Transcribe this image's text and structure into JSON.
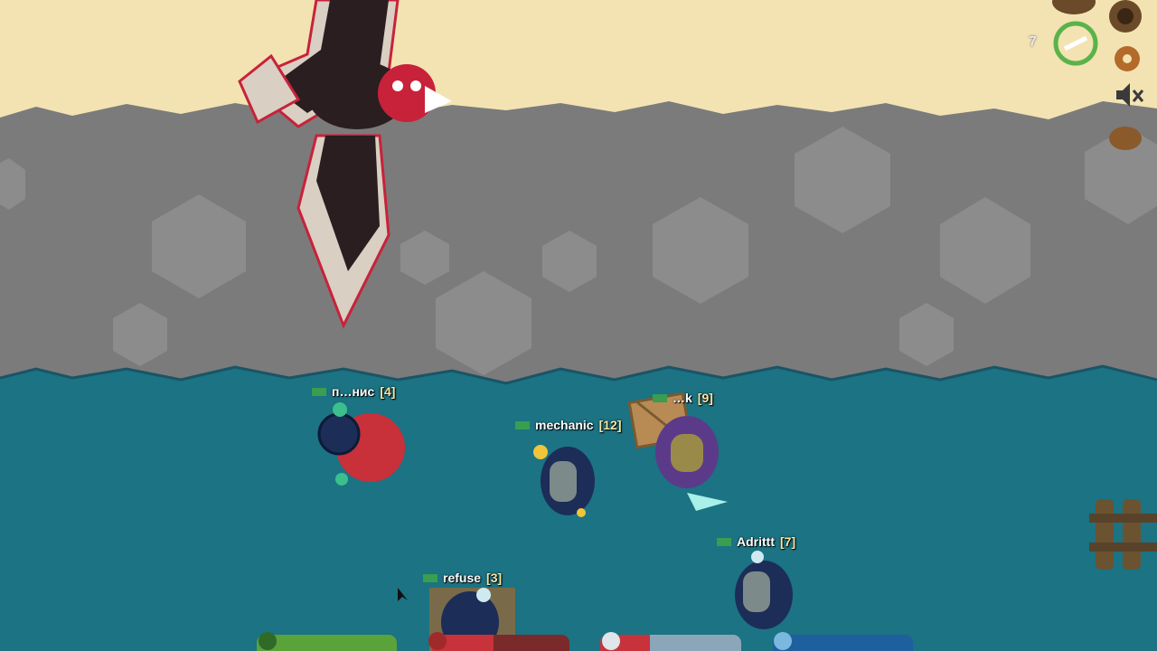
{
  "players": [
    {
      "name": "п…нис",
      "level": "[4]",
      "flag_color": "#3a9d4f"
    },
    {
      "name": "mechanic",
      "level": "[12]",
      "flag_color": "#3a9d4f"
    },
    {
      "name": "…k",
      "level": "[9]",
      "flag_color": "#3a9d4f"
    },
    {
      "name": "Adrittt",
      "level": "[7]",
      "flag_color": "#3a9d4f"
    },
    {
      "name": "refuse",
      "level": "[3]",
      "flag_color": "#3a9d4f"
    }
  ],
  "hud": {
    "xp_count": "7",
    "icons": [
      "shop-icon",
      "compass-icon",
      "reset-icon",
      "settings-gear-icon",
      "sound-muted-icon",
      "meat-food-icon"
    ]
  },
  "status_bars": {
    "health": {
      "icon": "heart-icon",
      "fraction": 1.0,
      "color": "#5aa23a"
    },
    "food": {
      "icon": "meat-icon",
      "fraction": 0.45,
      "color": "#c8323a"
    },
    "temperature": {
      "icon": "thermometer-icon",
      "fraction": 0.35,
      "color": "#c8323a"
    },
    "water": {
      "icon": "water-drop-icon",
      "fraction": 1.0,
      "color": "#1e5f9e"
    }
  },
  "colors": {
    "sky": "#f3e3b2",
    "rock": "#7a7a7a",
    "water": "#1b7383"
  }
}
